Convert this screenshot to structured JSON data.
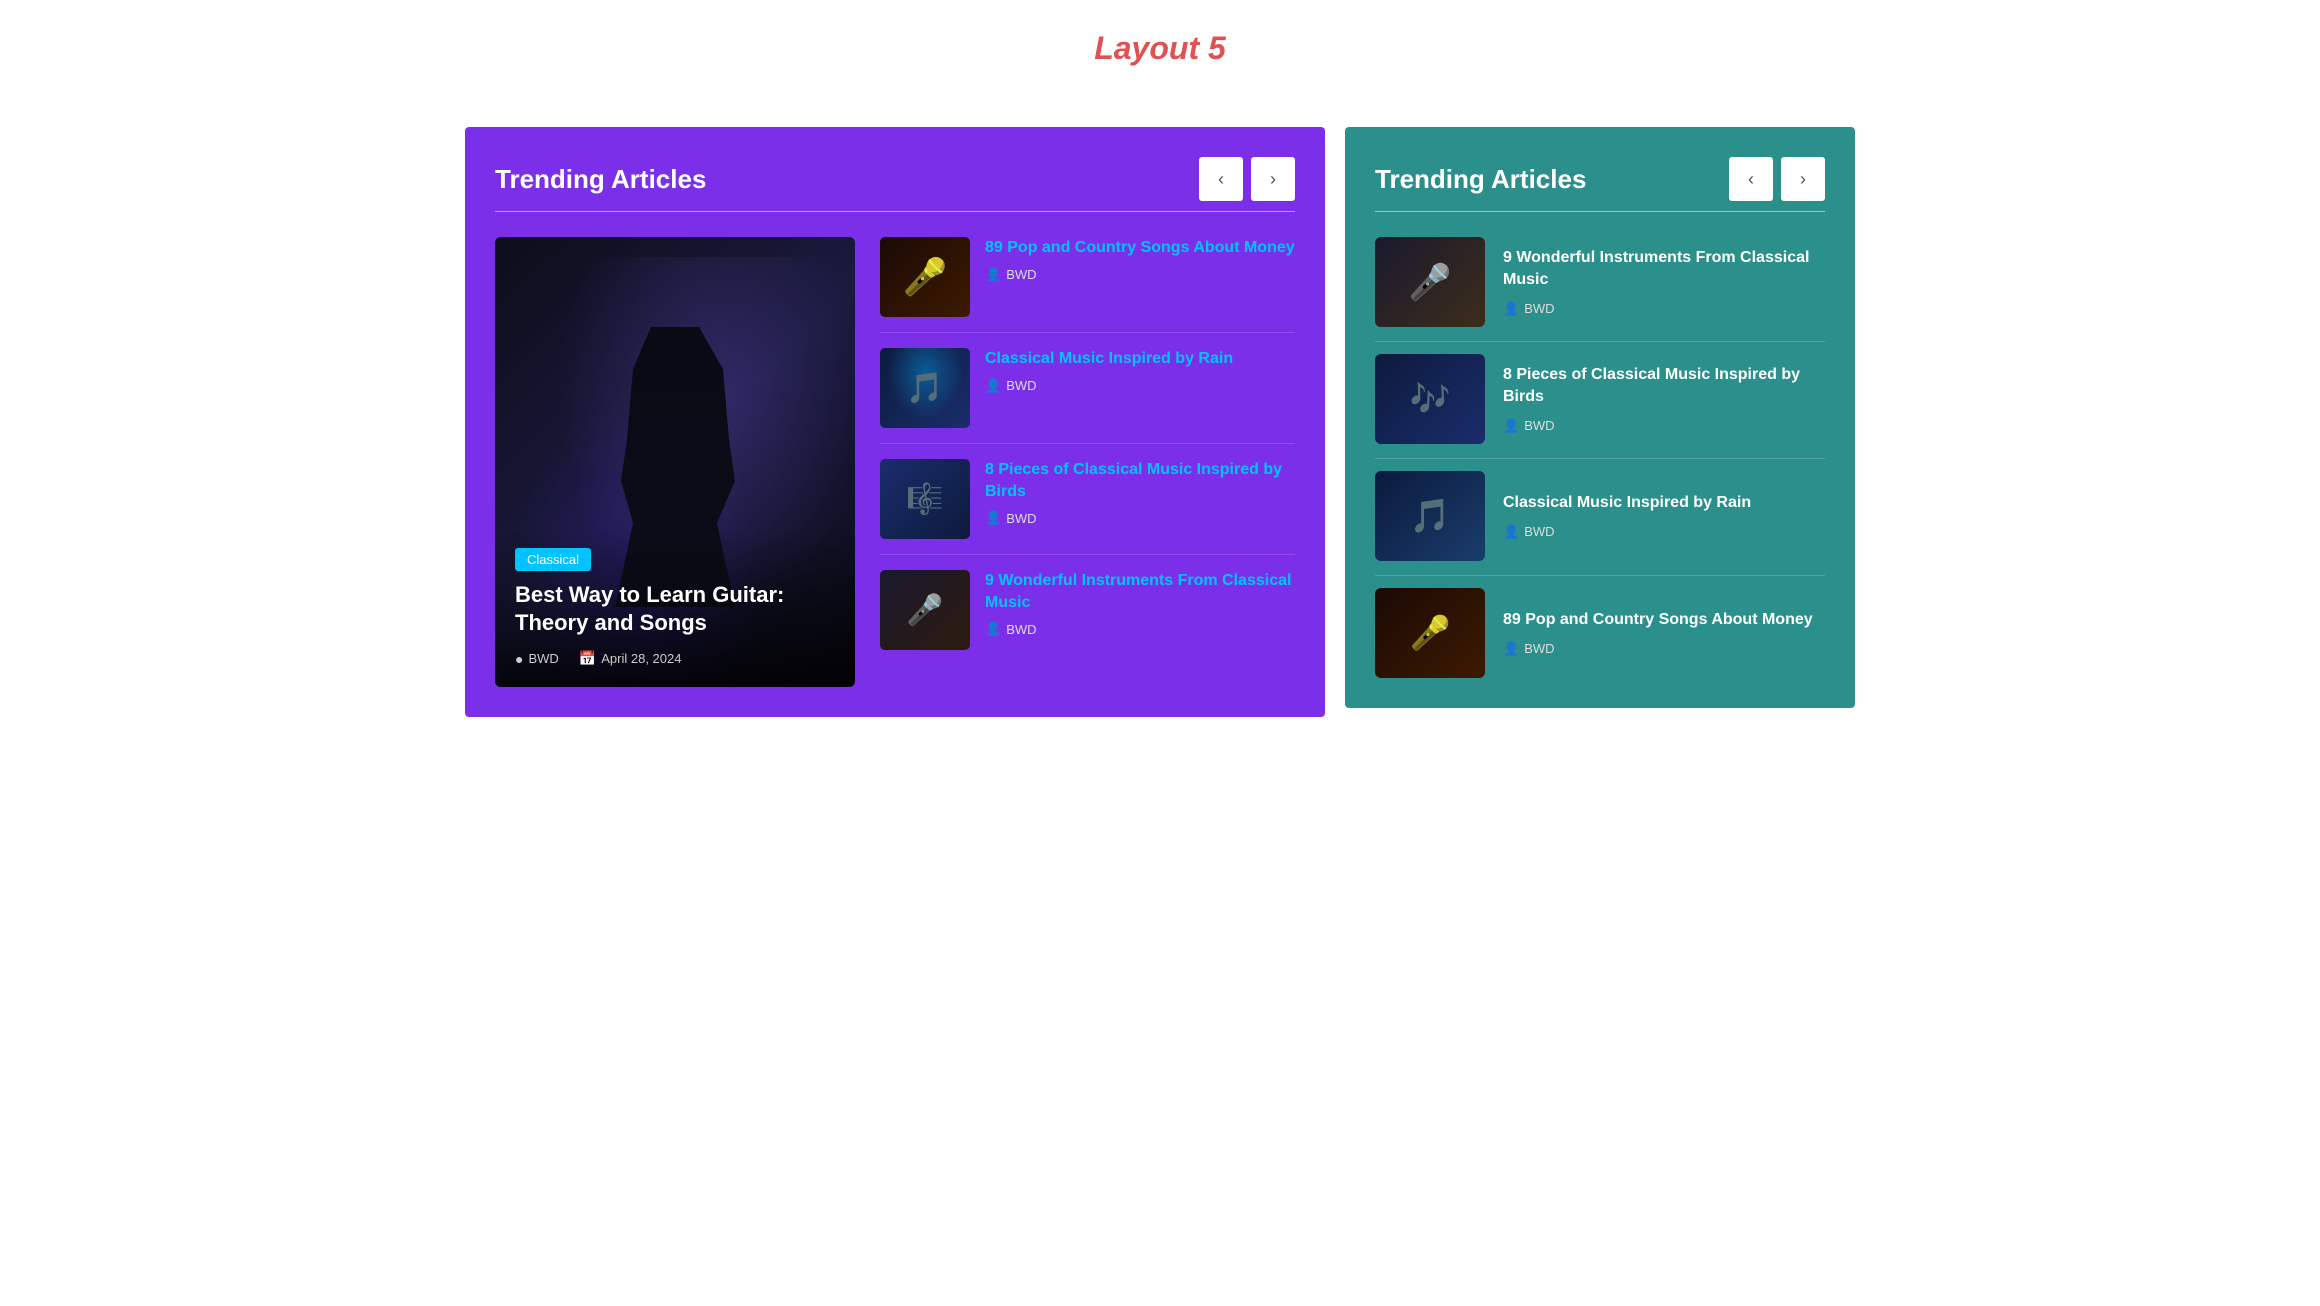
{
  "page": {
    "title": "Layout 5"
  },
  "left_panel": {
    "title": "Trending Articles",
    "nav": {
      "prev": "<",
      "next": ">"
    },
    "featured": {
      "category": "Classical",
      "title": "Best Way to Learn Guitar: Theory and Songs",
      "author": "BWD",
      "date": "April 28, 2024"
    },
    "articles": [
      {
        "title": "89 Pop and Country Songs About Money",
        "author": "BWD",
        "thumb_type": "mic"
      },
      {
        "title": "Classical Music Inspired by Rain",
        "author": "BWD",
        "thumb_type": "concert"
      },
      {
        "title": "8 Pieces of Classical Music Inspired by Birds",
        "author": "BWD",
        "thumb_type": "birds"
      },
      {
        "title": "9 Wonderful Instruments From Classical Music",
        "author": "BWD",
        "thumb_type": "singer"
      }
    ]
  },
  "right_panel": {
    "title": "Trending Articles",
    "nav": {
      "prev": "<",
      "next": ">"
    },
    "articles": [
      {
        "title": "9 Wonderful Instruments From Classical Music",
        "author": "BWD",
        "thumb_type": "singer2"
      },
      {
        "title": "8 Pieces of Classical Music Inspired by Birds",
        "author": "BWD",
        "thumb_type": "concert2"
      },
      {
        "title": "Classical Music Inspired by Rain",
        "author": "BWD",
        "thumb_type": "rain"
      },
      {
        "title": "89 Pop and Country Songs About Money",
        "author": "BWD",
        "thumb_type": "mic2"
      }
    ]
  }
}
